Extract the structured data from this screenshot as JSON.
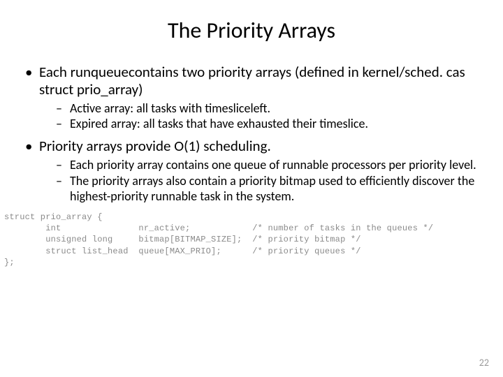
{
  "title": "The Priority Arrays",
  "bullets": [
    {
      "text": "Each runqueuecontains two priority arrays (defined in kernel/sched. cas struct prio_array)",
      "sub": [
        "Active array: all tasks with timesliceleft.",
        "Expired array: all tasks that have exhausted their timeslice."
      ]
    },
    {
      "text": "Priority arrays provide O(1) scheduling.",
      "sub": [
        "Each priority array contains one queue of runnable processors per priority level.",
        "The priority arrays also contain a priority bitmap used to efficiently discover the highest-priority runnable task in the system."
      ]
    }
  ],
  "code": "struct prio_array {\n        int               nr_active;            /* number of tasks in the queues */\n        unsigned long     bitmap[BITMAP_SIZE];  /* priority bitmap */\n        struct list_head  queue[MAX_PRIO];      /* priority queues */\n};",
  "page_number": "22"
}
